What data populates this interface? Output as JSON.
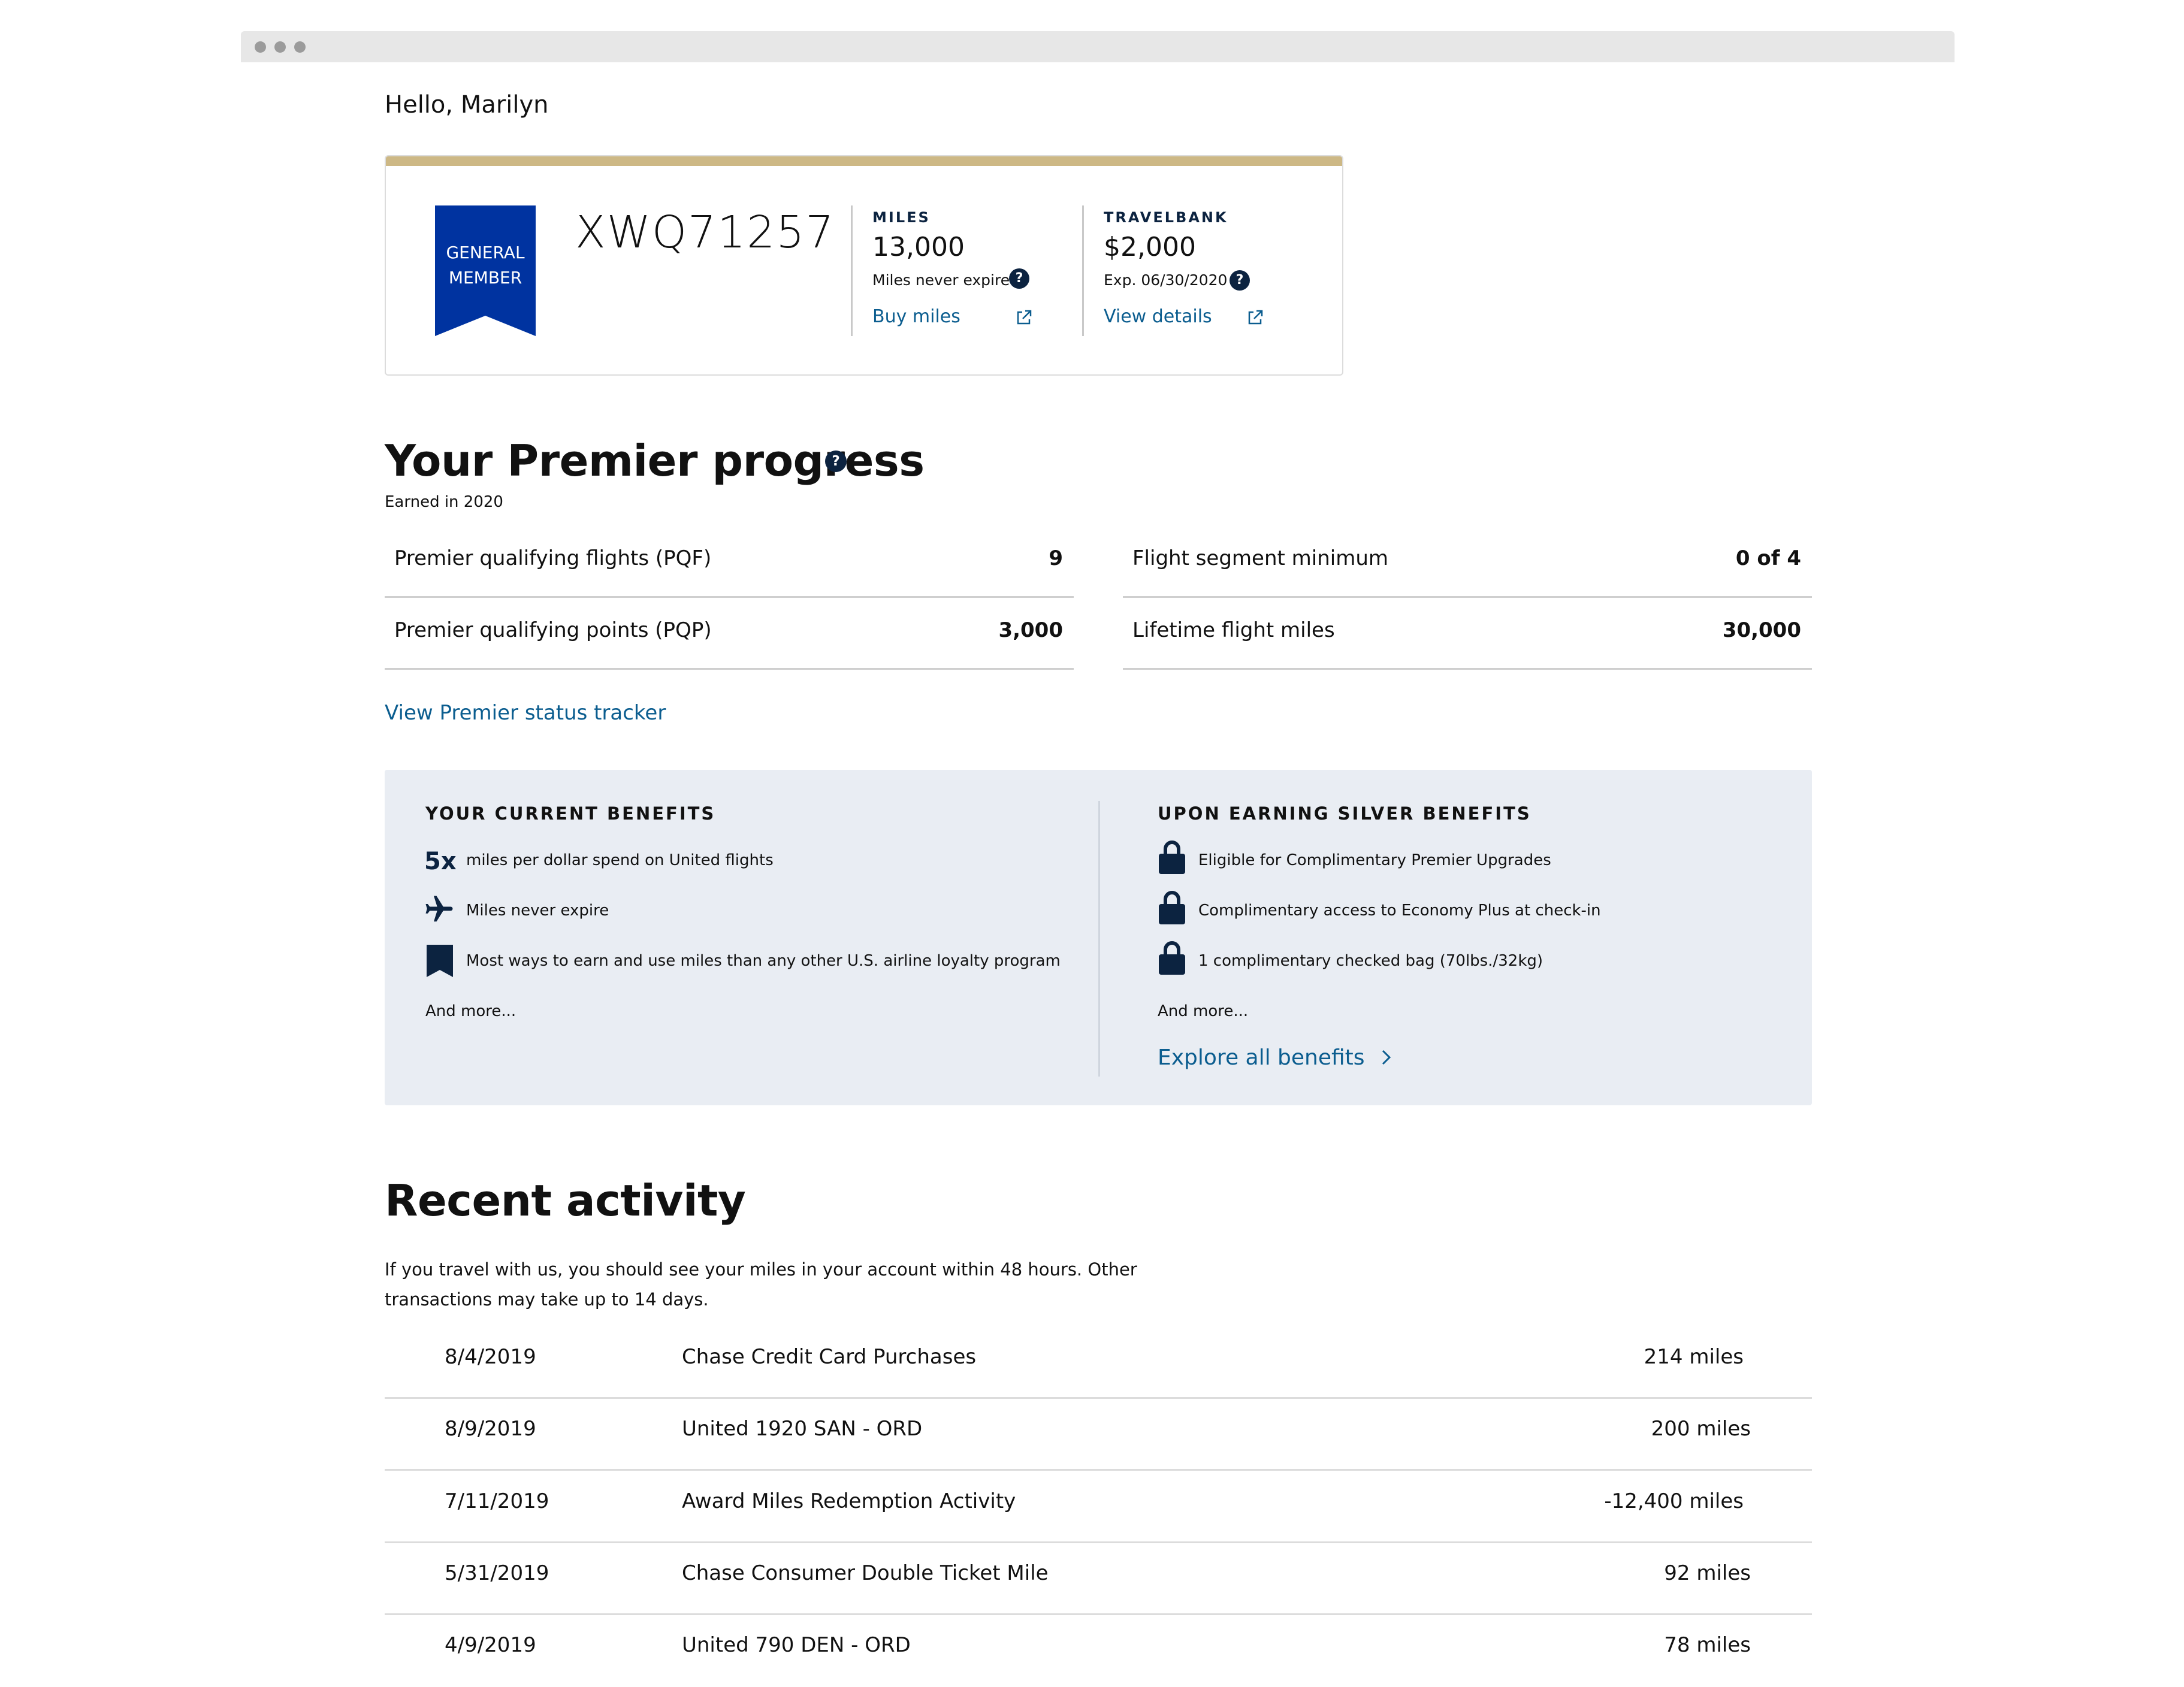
{
  "greeting": "Hello, Marilyn",
  "membership": {
    "tier_label_line1": "GENERAL",
    "tier_label_line2": "MEMBER",
    "member_number": "XWQ71257",
    "miles": {
      "label": "MILES",
      "value": "13,000",
      "note": "Miles never expire",
      "link": "Buy miles"
    },
    "travelbank": {
      "label": "TRAVELBANK",
      "value": "$2,000",
      "note": "Exp. 06/30/2020",
      "link": "View details"
    }
  },
  "premier": {
    "title": "Your Premier progress",
    "earned": "Earned in 2020",
    "stats": [
      {
        "label": "Premier qualifying flights (PQF)",
        "value": "9"
      },
      {
        "label": "Premier qualifying points (PQP)",
        "value": "3,000"
      },
      {
        "label": "Flight segment minimum",
        "value": "0 of 4"
      },
      {
        "label": "Lifetime flight miles",
        "value": "30,000"
      }
    ],
    "tracker_link": "View Premier status tracker"
  },
  "benefits": {
    "current_title": "YOUR CURRENT BENEFITS",
    "current_items": [
      {
        "icon": "5x",
        "text": "miles per dollar spend on United flights"
      },
      {
        "icon": "airplane-icon",
        "text": "Miles never expire"
      },
      {
        "icon": "bookmark-icon",
        "text": "Most ways to earn and use miles than any other U.S. airline loyalty program"
      }
    ],
    "current_more": "And more...",
    "silver_title": "UPON EARNING SILVER BENEFITS",
    "silver_items": [
      {
        "icon": "lock-icon",
        "text": "Eligible for Complimentary Premier Upgrades"
      },
      {
        "icon": "lock-icon",
        "text": "Complimentary access to Economy Plus at check-in"
      },
      {
        "icon": "lock-icon",
        "text": "1 complimentary checked bag (70lbs./32kg)"
      }
    ],
    "silver_more": "And more...",
    "explore_link": "Explore all benefits"
  },
  "activity": {
    "title": "Recent activity",
    "intro": "If you travel with us, you should see your miles in your account within 48 hours. Other transactions may take up to 14 days.",
    "rows": [
      {
        "date": "8/4/2019",
        "desc": "Chase Credit Card Purchases",
        "amount": "214 miles"
      },
      {
        "date": "8/9/2019",
        "desc": "United 1920 SAN - ORD",
        "amount": "200 miles"
      },
      {
        "date": "7/11/2019",
        "desc": "Award Miles Redemption Activity",
        "amount": "-12,400 miles"
      },
      {
        "date": "5/31/2019",
        "desc": "Chase Consumer Double Ticket Mile",
        "amount": "92 miles"
      },
      {
        "date": "4/9/2019",
        "desc": "United 790 DEN - ORD",
        "amount": "78 miles"
      }
    ]
  },
  "colors": {
    "navy": "#0c2340",
    "badge_blue": "#0033a0",
    "gold": "#cdb885",
    "link": "#0b5d8f",
    "benefits_bg": "#e9edf3"
  }
}
